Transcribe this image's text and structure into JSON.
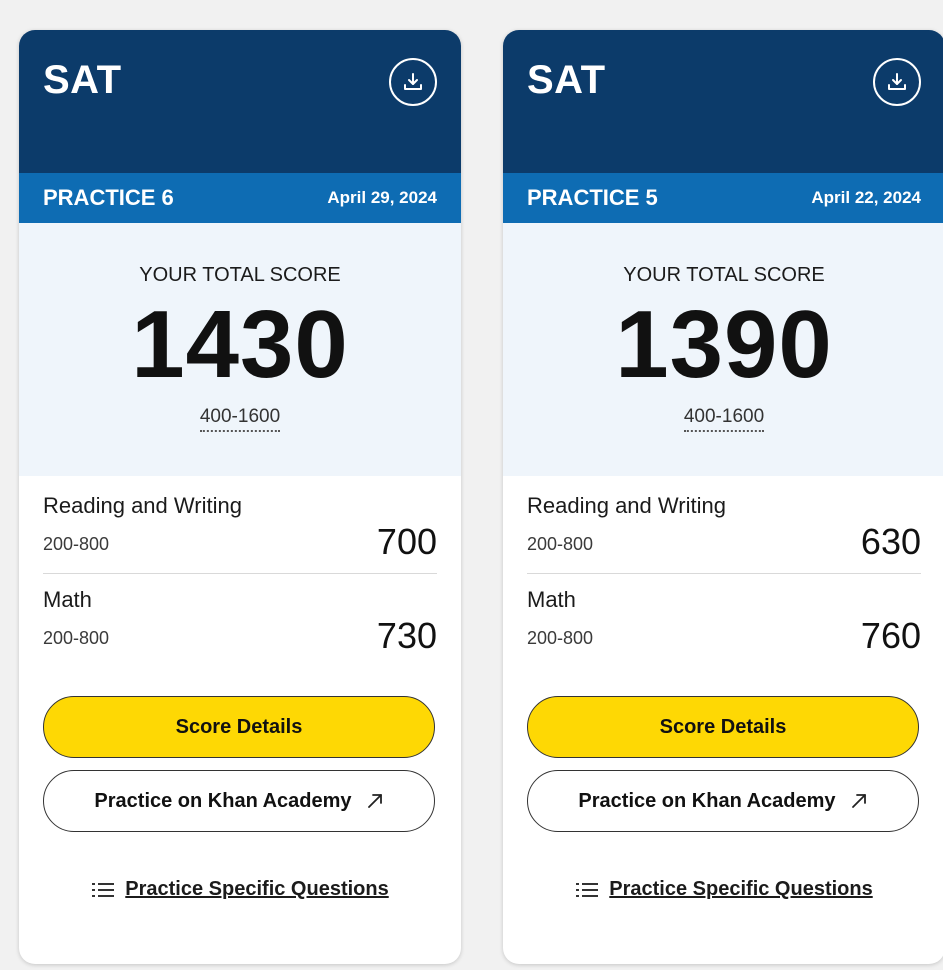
{
  "cards": [
    {
      "brand": "SAT",
      "practice_name": "PRACTICE 6",
      "date": "April 29, 2024",
      "total_label": "YOUR TOTAL SCORE",
      "total_score": "1430",
      "total_range": "400-1600",
      "sections": [
        {
          "name": "Reading and Writing",
          "range": "200-800",
          "score": "700"
        },
        {
          "name": "Math",
          "range": "200-800",
          "score": "730"
        }
      ],
      "details_label": "Score Details",
      "khan_label": "Practice on Khan Academy",
      "questions_label": "Practice Specific Questions"
    },
    {
      "brand": "SAT",
      "practice_name": "PRACTICE 5",
      "date": "April 22, 2024",
      "total_label": "YOUR TOTAL SCORE",
      "total_score": "1390",
      "total_range": "400-1600",
      "sections": [
        {
          "name": "Reading and Writing",
          "range": "200-800",
          "score": "630"
        },
        {
          "name": "Math",
          "range": "200-800",
          "score": "760"
        }
      ],
      "details_label": "Score Details",
      "khan_label": "Practice on Khan Academy",
      "questions_label": "Practice Specific Questions"
    }
  ],
  "colors": {
    "header_bg": "#0c3b6a",
    "practice_bar_bg": "#0e6cb3",
    "score_panel_bg": "#eff5fb",
    "primary_button_bg": "#fed804"
  },
  "icons": {
    "download": "download-icon",
    "external_link": "external-link-icon",
    "list": "list-icon"
  }
}
